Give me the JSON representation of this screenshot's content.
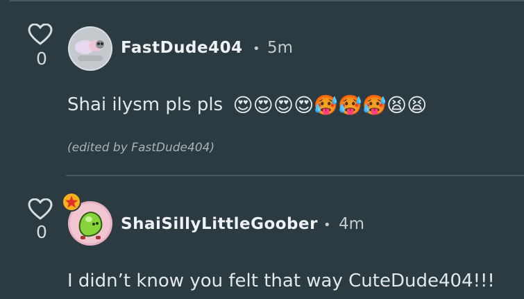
{
  "comments": [
    {
      "likes": "0",
      "username": "FastDude404",
      "separator": "•",
      "time": "5m",
      "text": "Shai ilysm pls pls",
      "emojis": [
        "😍",
        "😍",
        "😍",
        "😍",
        "🥵",
        "🥵",
        "🥵",
        "😫",
        "😫"
      ],
      "edited_note": "(edited by FastDude404)"
    },
    {
      "likes": "0",
      "username": "ShaiSillyLittleGoober",
      "separator": "•",
      "time": "4m",
      "text": "I didn’t know you felt that way CuteDude404!!!"
    }
  ],
  "colors": {
    "background": "#2c3a41",
    "divider": "#4b5a61",
    "badge": "#f5b21a"
  },
  "icons": {
    "like": "heart-outline-icon",
    "badge": "star-badge-icon"
  }
}
